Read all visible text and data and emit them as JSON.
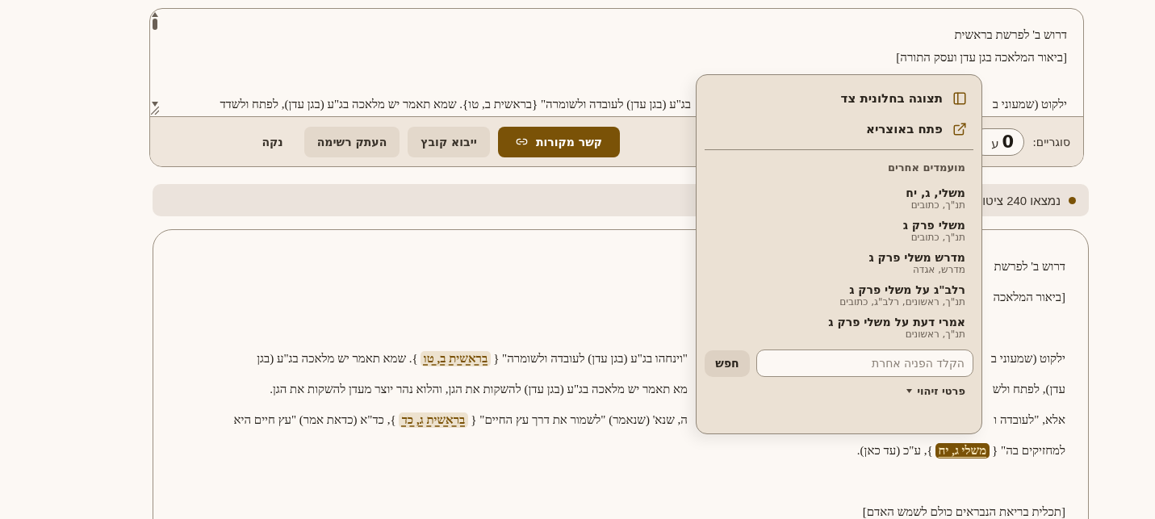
{
  "editor": {
    "lines": [
      {
        "right": "דרוש ב' לפרשת בראשית"
      },
      {
        "right": "[ביאור המלאכה בגן עדן ועסק התורה]"
      },
      {
        "right": "ילקוט (שמעוני ב",
        "left": "בג\"ע (בגן עדן) לעובדה ולשומרה\" {בראשית ב, טו}. שמא תאמר יש מלאכה בג\"ע (בגן עדן), לפתח ולשדד",
        "space_before": true
      }
    ]
  },
  "toolbar": {
    "brackets_label": "סוגריים:",
    "brackets_count": "0",
    "brackets_unit": "ע",
    "buttons": [
      {
        "label": "קשר מקורות",
        "kind": "primary"
      },
      {
        "label": "ייבוא קובץ",
        "kind": "secondary"
      },
      {
        "label": "העתק רשימה",
        "kind": "secondary"
      },
      {
        "label": "נקה",
        "kind": "plain"
      }
    ]
  },
  "status": {
    "text": "נמצאו 240 ציטו"
  },
  "document": {
    "lines": [
      {
        "right": [
          {
            "kind": "text",
            "text": "דרוש ב' לפרשת"
          }
        ]
      },
      {
        "right": [
          {
            "kind": "text",
            "text": "[ביאור המלאכה"
          }
        ]
      },
      {
        "space_before": true,
        "right": [
          {
            "kind": "text",
            "text": "ילקוט (שמעוני ב"
          }
        ],
        "left": [
          {
            "kind": "text",
            "text": "\"וינחהו בג\"ע (בגן עדן) לעובדה ולשומרה\" {"
          },
          {
            "kind": "source",
            "text": "בראשית ב, טו",
            "active": false
          },
          {
            "kind": "text",
            "text": "}. שמא תאמר יש מלאכה בג\"ע (בגן"
          }
        ]
      },
      {
        "right": [
          {
            "kind": "text",
            "text": "עדן), לפתח ולש"
          }
        ],
        "left": [
          {
            "kind": "text",
            "text": "מא תאמר יש מלאכה בג\"ע (בגן עדן) להשקות את הגן, והלוא נהר יוצר מעדן להשקות את הגן."
          }
        ]
      },
      {
        "right": [
          {
            "kind": "text",
            "text": "אלא, \"לעובדה ו"
          }
        ],
        "left": [
          {
            "kind": "text",
            "text": "ה, שנא' (שנאמר) \"לשמור את דרך עץ החיים\" {"
          },
          {
            "kind": "source",
            "text": "בראשית ג, כד",
            "active": false
          },
          {
            "kind": "text",
            "text": "}, כד\"א (כדאת אמר) \"עץ חיים היא"
          }
        ]
      },
      {
        "right": [
          {
            "kind": "text",
            "text": "למחזיקים בה\" {"
          },
          {
            "kind": "source",
            "text": "משלי ג, יח",
            "active": true
          },
          {
            "kind": "text",
            "text": "}, ע\"כ (עד כאן)."
          }
        ]
      },
      {
        "space_before": true,
        "right": [
          {
            "kind": "text",
            "text": "[תכלית בריאת הנבראים כולם לשמש האדם]"
          }
        ]
      }
    ]
  },
  "popup": {
    "actions": [
      {
        "label": "תצוגה בחלונית צד"
      },
      {
        "label": "פתח באוצריא"
      }
    ],
    "heading": "מועמדים אחרים",
    "candidates": [
      {
        "title": "משלי, ג, יח",
        "subtitle": "תנ\"ך, כתובים"
      },
      {
        "title": "משלי פרק ג",
        "subtitle": "תנ\"ך, כתובים"
      },
      {
        "title": "מדרש משלי פרק ג",
        "subtitle": "מדרש, אגדה"
      },
      {
        "title": "רלב\"ג על משלי פרק ג",
        "subtitle": "תנ\"ך, ראשונים, רלב\"ג, כתובים"
      },
      {
        "title": "אמרי דעת על משלי פרק ג",
        "subtitle": "תנ\"ך, ראשונים"
      }
    ],
    "search": {
      "placeholder": "הקלד הפניה אחרת",
      "button": "חפש"
    },
    "details": {
      "label": "פרטי זיהוי",
      "expanded": false
    }
  }
}
